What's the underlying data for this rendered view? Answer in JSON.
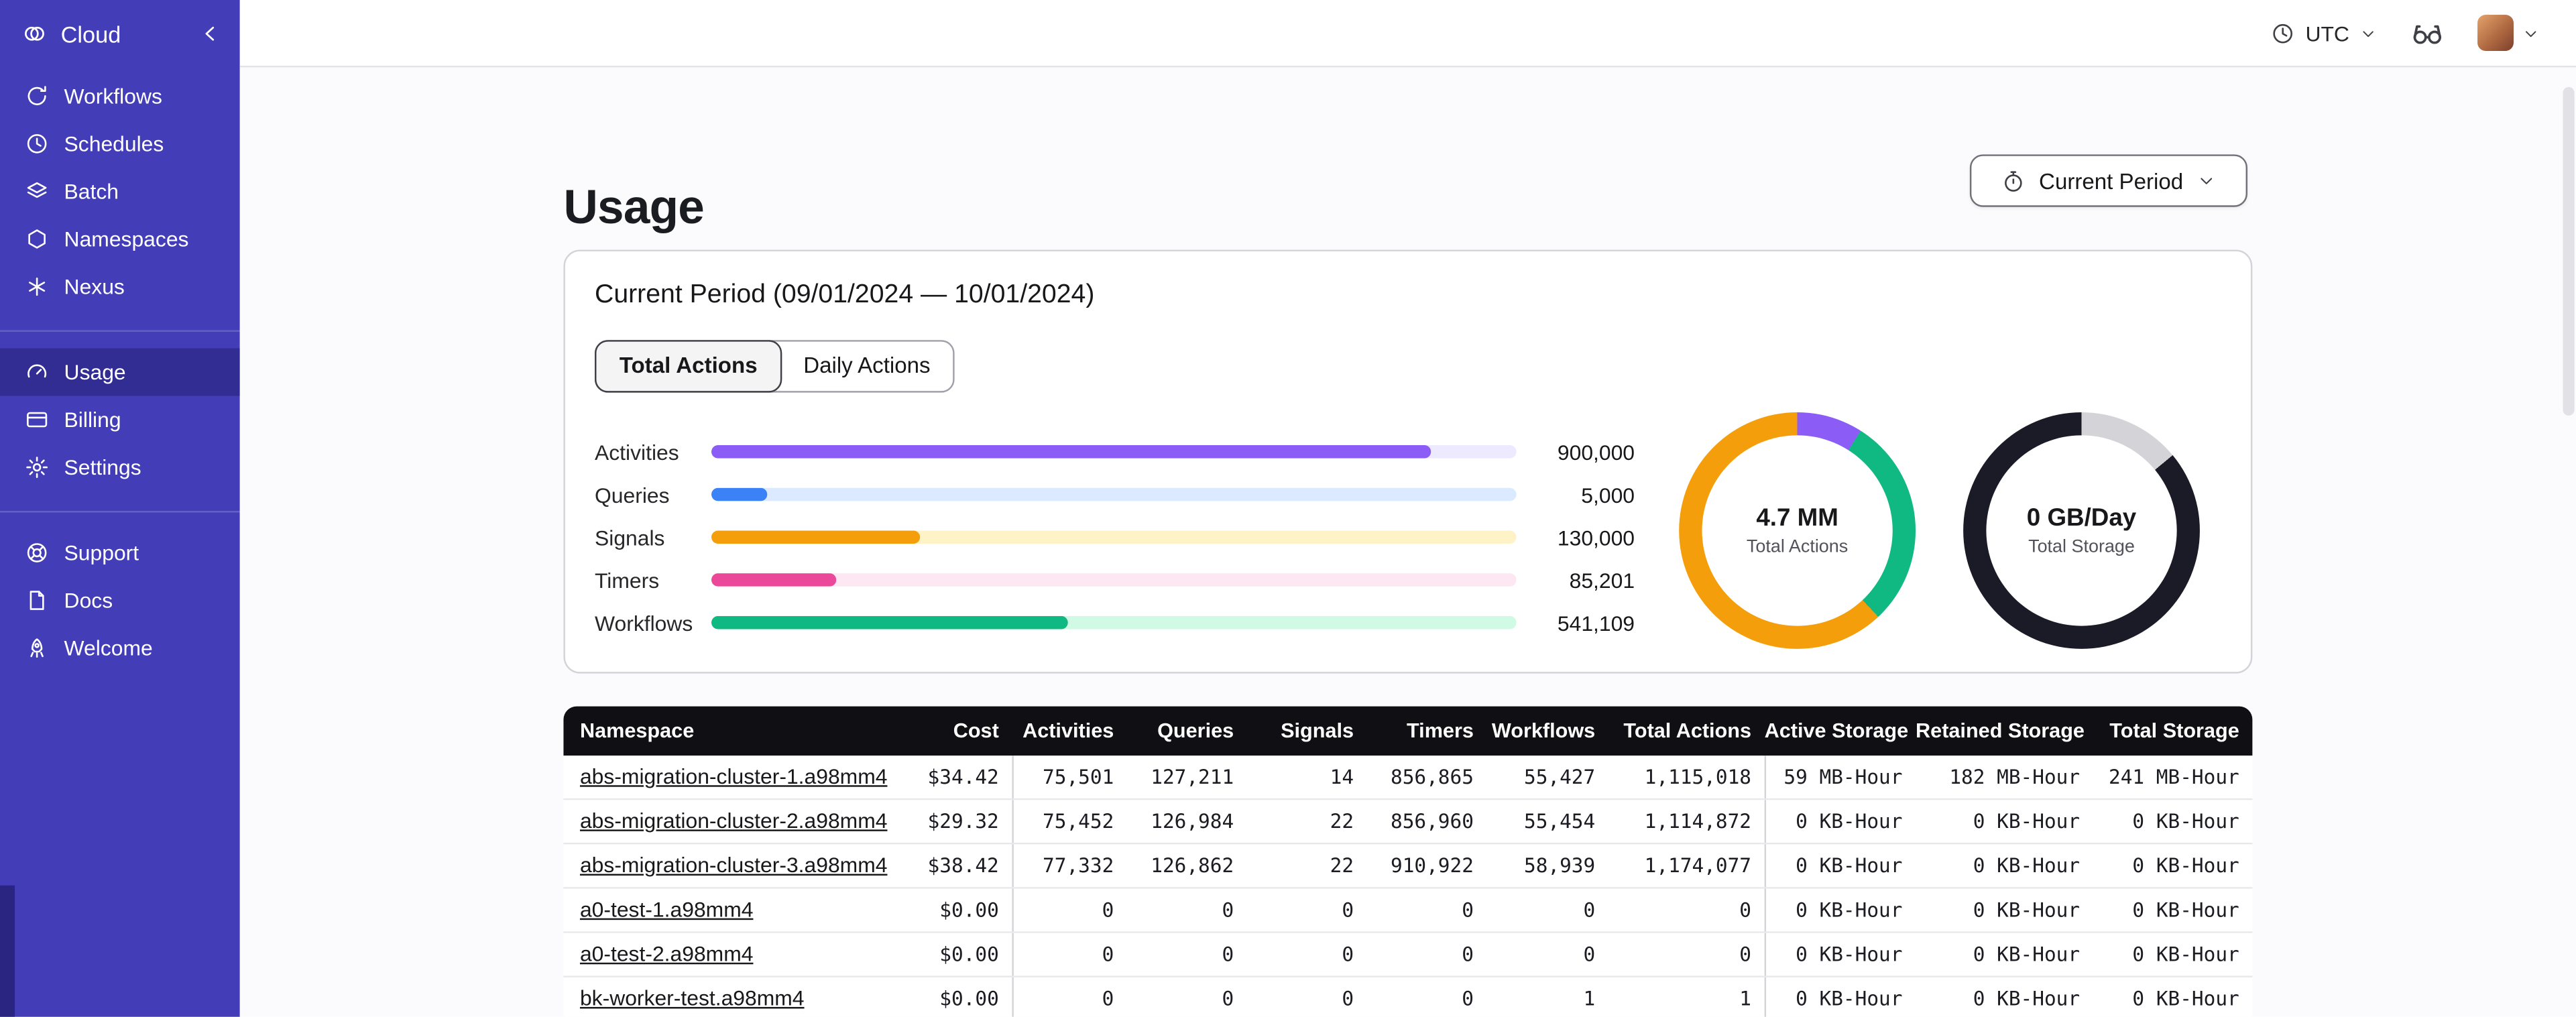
{
  "colors": {
    "sidebar_bg": "#433db8",
    "sidebar_active_bg": "#322d92",
    "table_header_bg": "#101014",
    "activities": "#8b5cf6",
    "queries": "#3b82f6",
    "signals": "#f59e0b",
    "timers": "#ec4899",
    "workflows": "#10b981"
  },
  "sidebar": {
    "brand_label": "Cloud",
    "nav_main": [
      {
        "label": "Workflows"
      },
      {
        "label": "Schedules"
      },
      {
        "label": "Batch"
      },
      {
        "label": "Namespaces"
      },
      {
        "label": "Nexus"
      }
    ],
    "nav_account": [
      {
        "label": "Usage",
        "active": true
      },
      {
        "label": "Billing",
        "active": false
      },
      {
        "label": "Settings",
        "active": false
      }
    ],
    "nav_footer": [
      {
        "label": "Support"
      },
      {
        "label": "Docs"
      },
      {
        "label": "Welcome"
      }
    ]
  },
  "topbar": {
    "timezone_label": "UTC"
  },
  "page": {
    "title": "Usage",
    "period_button_label": "Current Period"
  },
  "usage_card": {
    "title": "Current Period (09/01/2024 — 10/01/2024)",
    "tabs": [
      {
        "label": "Total Actions",
        "active": true
      },
      {
        "label": "Daily Actions",
        "active": false
      }
    ]
  },
  "chart_data": [
    {
      "type": "bar",
      "orientation": "horizontal",
      "title": "Current Period (09/01/2024 — 10/01/2024)",
      "categories": [
        "Activities",
        "Queries",
        "Signals",
        "Timers",
        "Workflows"
      ],
      "values": [
        900000,
        5000,
        130000,
        85201,
        541109
      ],
      "rows": [
        {
          "label": "Activities",
          "value": 900000,
          "value_label": "900,000",
          "fill_css": "89.4%",
          "color": "#8b5cf6",
          "track": "#ede9fe"
        },
        {
          "label": "Queries",
          "value": 5000,
          "value_label": "5,000",
          "fill_css": "7%",
          "color": "#3b82f6",
          "track": "#dbeafe"
        },
        {
          "label": "Signals",
          "value": 130000,
          "value_label": "130,000",
          "fill_css": "26%",
          "color": "#f59e0b",
          "track": "#fef3c7"
        },
        {
          "label": "Timers",
          "value": 85201,
          "value_label": "85,201",
          "fill_css": "15.5%",
          "color": "#ec4899",
          "track": "#fce7f3"
        },
        {
          "label": "Workflows",
          "value": 541109,
          "value_label": "541,109",
          "fill_css": "44.3%",
          "color": "#10b981",
          "track": "#d1fae5"
        }
      ]
    },
    {
      "type": "pie",
      "center_value": "4.7 MM",
      "center_label": "Total Actions",
      "slices": [
        {
          "name": "segment-purple",
          "color": "#8b5cf6",
          "pct": 9
        },
        {
          "name": "segment-green",
          "color": "#10b981",
          "pct": 29
        },
        {
          "name": "segment-orange",
          "color": "#f59e0b",
          "pct": 62
        }
      ]
    },
    {
      "type": "pie",
      "center_value": "0 GB/Day",
      "center_label": "Total Storage",
      "slices": [
        {
          "name": "segment-light",
          "color": "#d4d4d8",
          "pct": 14
        },
        {
          "name": "segment-dark",
          "color": "#1b1b27",
          "pct": 86
        }
      ]
    }
  ],
  "table": {
    "columns": [
      "Namespace",
      "Cost",
      "Activities",
      "Queries",
      "Signals",
      "Timers",
      "Workflows",
      "Total Actions",
      "Active Storage",
      "Retained Storage",
      "Total Storage"
    ],
    "rows": [
      {
        "namespace": "abs-migration-cluster-1.a98mm4",
        "cost": "$34.42",
        "activities": "75,501",
        "queries": "127,211",
        "signals": "14",
        "timers": "856,865",
        "workflows": "55,427",
        "total_actions": "1,115,018",
        "active_storage": "59 MB-Hour",
        "retained_storage": "182 MB-Hour",
        "total_storage": "241 MB-Hour"
      },
      {
        "namespace": "abs-migration-cluster-2.a98mm4",
        "cost": "$29.32",
        "activities": "75,452",
        "queries": "126,984",
        "signals": "22",
        "timers": "856,960",
        "workflows": "55,454",
        "total_actions": "1,114,872",
        "active_storage": "0 KB-Hour",
        "retained_storage": "0 KB-Hour",
        "total_storage": "0 KB-Hour"
      },
      {
        "namespace": "abs-migration-cluster-3.a98mm4",
        "cost": "$38.42",
        "activities": "77,332",
        "queries": "126,862",
        "signals": "22",
        "timers": "910,922",
        "workflows": "58,939",
        "total_actions": "1,174,077",
        "active_storage": "0 KB-Hour",
        "retained_storage": "0 KB-Hour",
        "total_storage": "0 KB-Hour"
      },
      {
        "namespace": "a0-test-1.a98mm4",
        "cost": "$0.00",
        "activities": "0",
        "queries": "0",
        "signals": "0",
        "timers": "0",
        "workflows": "0",
        "total_actions": "0",
        "active_storage": "0 KB-Hour",
        "retained_storage": "0 KB-Hour",
        "total_storage": "0 KB-Hour"
      },
      {
        "namespace": "a0-test-2.a98mm4",
        "cost": "$0.00",
        "activities": "0",
        "queries": "0",
        "signals": "0",
        "timers": "0",
        "workflows": "0",
        "total_actions": "0",
        "active_storage": "0 KB-Hour",
        "retained_storage": "0 KB-Hour",
        "total_storage": "0 KB-Hour"
      },
      {
        "namespace": "bk-worker-test.a98mm4",
        "cost": "$0.00",
        "activities": "0",
        "queries": "0",
        "signals": "0",
        "timers": "0",
        "workflows": "1",
        "total_actions": "1",
        "active_storage": "0 KB-Hour",
        "retained_storage": "0 KB-Hour",
        "total_storage": "0 KB-Hour"
      }
    ]
  }
}
